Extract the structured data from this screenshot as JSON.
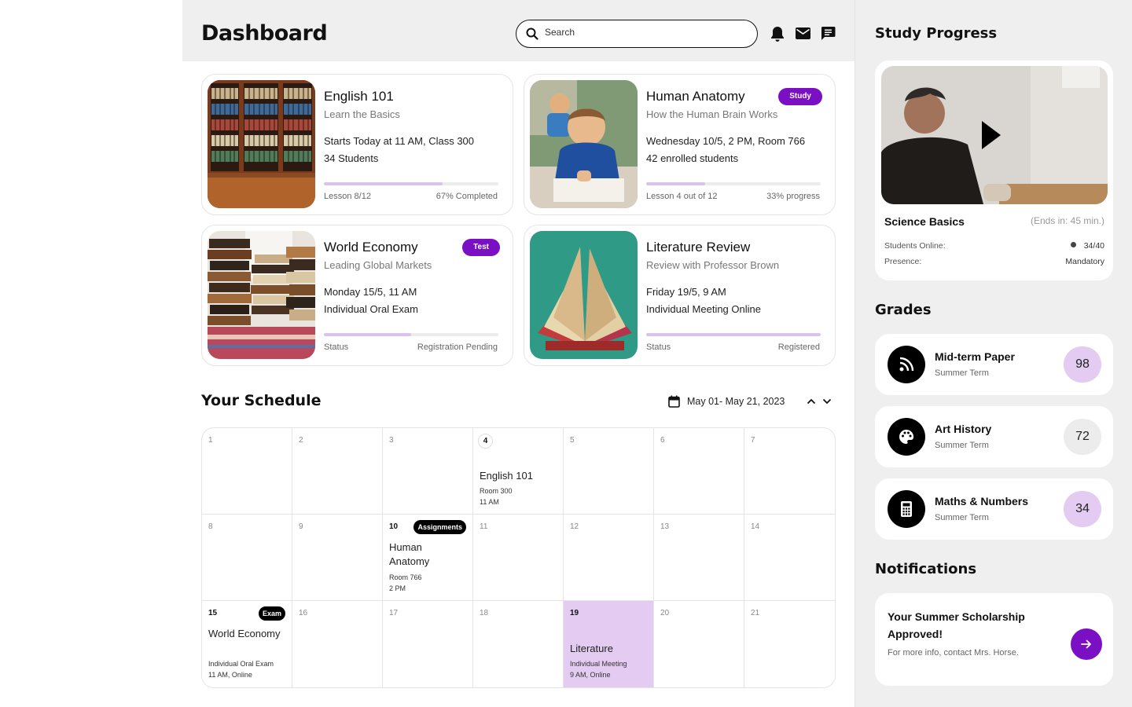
{
  "header": {
    "title": "Dashboard",
    "search_placeholder": "Search",
    "icons": [
      "bell-icon",
      "mail-icon",
      "chat-icon"
    ]
  },
  "courses": [
    {
      "title": "English 101",
      "subtitle": "Learn the Basics",
      "line1": "Starts Today at 11 AM, Class 300",
      "line2": "34 Students",
      "progress": 0.68,
      "foot_left": "Lesson 8/12",
      "foot_right": "67% Completed",
      "tag": ""
    },
    {
      "title": "Human Anatomy",
      "subtitle": "How the Human Brain Works",
      "line1": "Wednesday 10/5, 2 PM, Room 766",
      "line2": "42 enrolled students",
      "progress": 0.34,
      "foot_left": "Lesson 4 out of 12",
      "foot_right": "33% progress",
      "tag": "Study"
    },
    {
      "title": "World Economy",
      "subtitle": "Leading Global Markets",
      "line1": "Monday 15/5, 11 AM",
      "line2": "Individual Oral Exam",
      "progress": 0.5,
      "foot_left": "Status",
      "foot_right": "Registration Pending",
      "tag": "Test"
    },
    {
      "title": "Literature Review",
      "subtitle": "Review with Professor Brown",
      "line1": "Friday 19/5, 9 AM",
      "line2": "Individual Meeting Online",
      "progress": 1.0,
      "foot_left": "Status",
      "foot_right": "Registered",
      "tag": ""
    }
  ],
  "schedule": {
    "title": "Your Schedule",
    "range": "May 01- May 21, 2023",
    "days": [
      "1",
      "2",
      "3",
      "4",
      "5",
      "6",
      "7",
      "8",
      "9",
      "10",
      "11",
      "12",
      "13",
      "14",
      "15",
      "16",
      "17",
      "18",
      "19",
      "20",
      "21"
    ],
    "events": {
      "english": {
        "title": "English 101",
        "room": "Room 300",
        "time": "11 AM"
      },
      "anatomy": {
        "badge": "Assignments",
        "title1": "Human",
        "title2": "Anatomy",
        "room": "Room 766",
        "time": "2 PM"
      },
      "economy": {
        "badge": "Exam",
        "title": "World Economy",
        "sub1": "Individual Oral Exam",
        "sub2": "11 AM, Online"
      },
      "literature": {
        "title": "Literature",
        "sub1": "Individual Meeting",
        "sub2": "9 AM, Online"
      }
    },
    "highlight_color": "#e3cbf2"
  },
  "study_progress": {
    "heading": "Study Progress",
    "course": "Science Basics",
    "ends": "(Ends in: 45 min.)",
    "online_label": "Students Online:",
    "online_value": "34/40",
    "presence_label": "Presence:",
    "presence_value": "Mandatory"
  },
  "grades": {
    "heading": "Grades",
    "items": [
      {
        "name": "Mid-term Paper",
        "term": "Summer Term",
        "score": "98",
        "icon": "rss-icon",
        "score_bg": "#e3cbf2"
      },
      {
        "name": "Art History",
        "term": "Summer Term",
        "score": "72",
        "icon": "palette-icon",
        "score_bg": "#ececec"
      },
      {
        "name": "Maths & Numbers",
        "term": "Summer Term",
        "score": "34",
        "icon": "calculator-icon",
        "score_bg": "#e3cbf2"
      }
    ]
  },
  "notifications": {
    "heading": "Notifications",
    "title": "Your Summer Scholarship Approved!",
    "sub": "For more info, contact Mrs. Horse."
  },
  "colors": {
    "accent": "#7a0fc4",
    "progress": "#dcc1ee"
  }
}
